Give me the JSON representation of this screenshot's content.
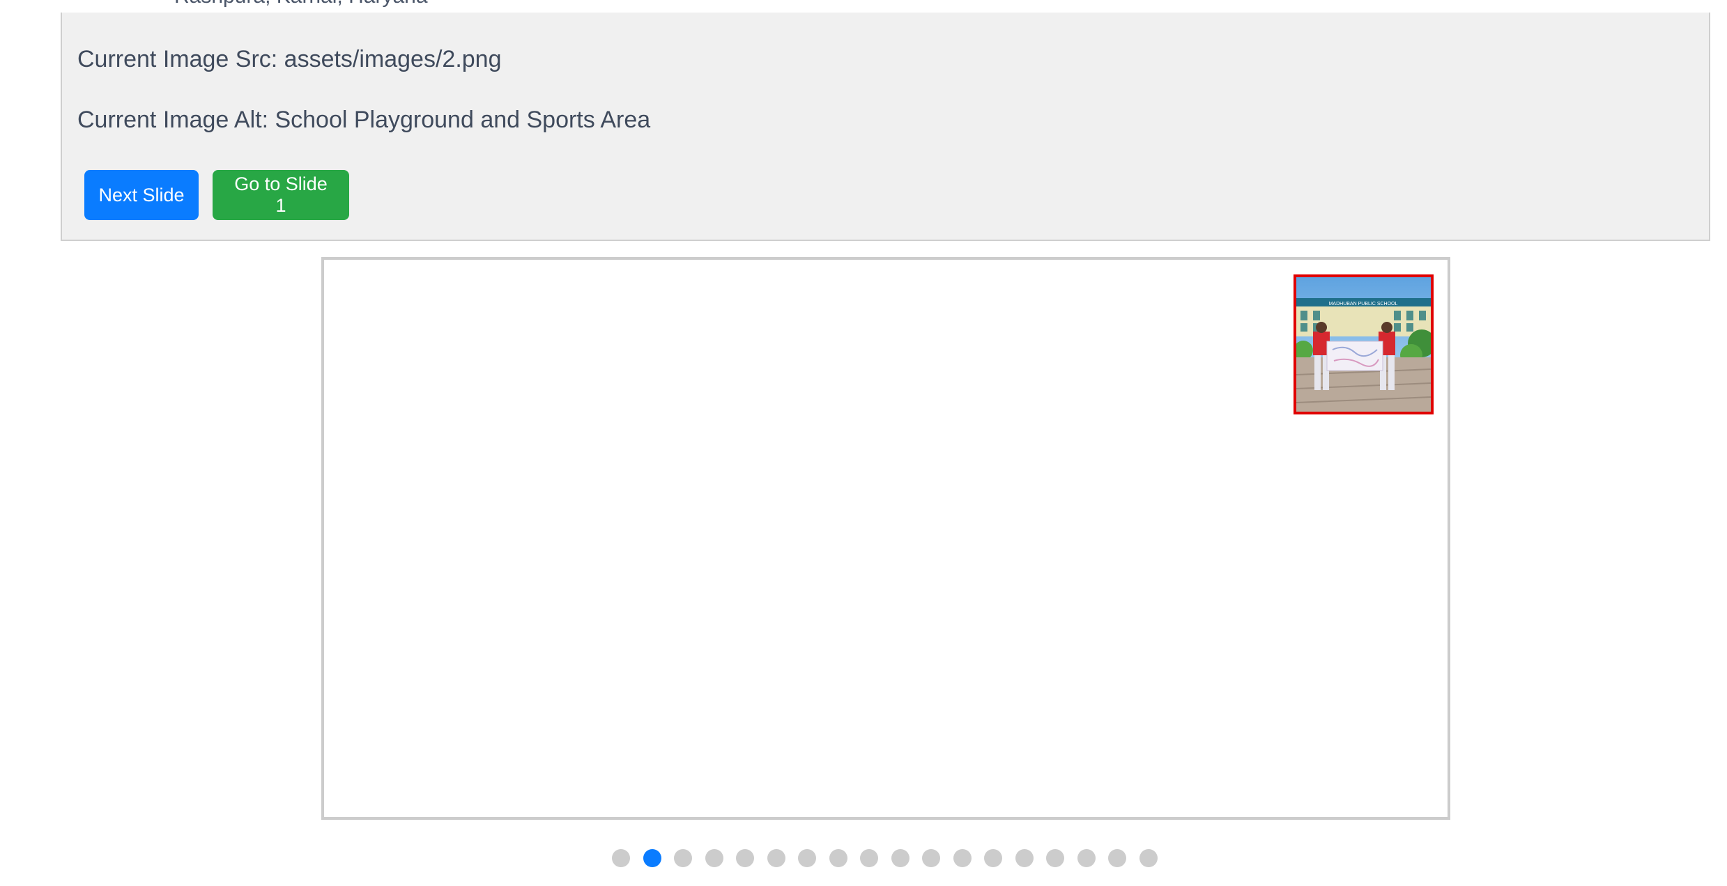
{
  "header": {
    "location_text": "Rasnpura, Karnal, Haryana"
  },
  "debug": {
    "src_line": "Current Image Src: assets/images/2.png",
    "alt_line": "Current Image Alt: School Playground and Sports Area"
  },
  "controls": {
    "next_label": "Next Slide",
    "goto_label": "Go to Slide 1"
  },
  "thumbnail": {
    "sign_text": "MADHUBAN PUBLIC SCHOOL"
  },
  "carousel": {
    "total_slides": 18,
    "active_index": 1
  },
  "colors": {
    "primary_button": "#0a7cff",
    "success_button": "#28a745",
    "thumbnail_border": "#e00000",
    "dot_active": "#0a7cff",
    "dot_inactive": "#cccccc"
  }
}
